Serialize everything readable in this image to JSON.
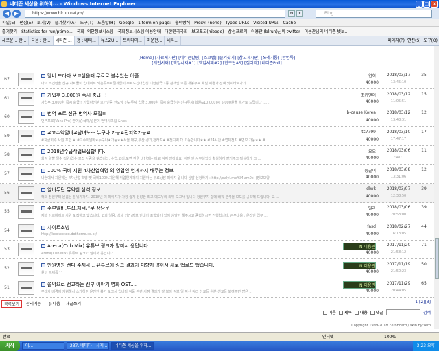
{
  "window": {
    "title": "네티즌 세상을 위하여... - Windows Internet Explorer"
  },
  "address": {
    "url": "https://www.blrun.net/m/",
    "search_placeholder": "Bing"
  },
  "menu": {
    "items": [
      "파일(E)",
      "편집(E)",
      "보기(V)",
      "즐겨찾기(A)",
      "도구(T)",
      "도움말(H)",
      "Google",
      "1 form on page:",
      "출력방식",
      "Proxy: (none)",
      "Typed URLs",
      "Visited URLs",
      "Cache"
    ]
  },
  "favorites": {
    "items": [
      "즐겨찾기",
      "Statistics for run/ptime...",
      "국회 -의안정보시스템",
      "국회정보시스템 이용안내",
      "대한민국국회",
      "보고포고(hibogo)",
      "삼성프로맥",
      "이용관 (blrun)님의 twitter",
      "이용관님의 네티즌 벗보..."
    ]
  },
  "tabs": {
    "items": [
      "새로운... 한...",
      "다음 : 한...",
      "네티즌 ...",
      "홍 : 네티...",
      "뉴스ZU...",
      "트위터의...",
      "미운전...",
      "네티..."
    ],
    "controls": [
      "페이지(P)",
      "안전(S)",
      "도구(O)"
    ]
  },
  "nav": {
    "line1": "[Home] [자료게시판] [네티즌칼럼] [스크랩] [즐겨찾기] [참고게시판] [쓰레기통] [방명록]",
    "line2": "[개인서재] [백업서재#1] [백업서재#2] [합조단AS] [갤러리] [네티즌Poll]"
  },
  "rows": [
    {
      "num": "62",
      "title": "멤버 드라마 보고싶을때 무료로 볼수있는 어플",
      "sub": "아이 조건만을 신규 자료들이 업데이트 되는곳무료결제없이 무료도간어입성 대한민국 1등 검색앱 모든 개봉무료 채널 예쁜과 진액 멋지바로가기 ...",
      "author": "연희",
      "views": "40000",
      "date": "2018/03/17",
      "time": "13:45:10",
      "count": "35"
    },
    {
      "num": "61",
      "title": "가입후 3,000원 즉시 충급!!!",
      "sub": "가입후 3,000원 즉시 충급!! 가입하신분 모인인증 한도당 신규투자 입금 3,000원 즉시 충급하는 신규투자(회원&10,000)시 5,000원을 추가로 드립니다 ......",
      "author": "조키맨어",
      "views": "40000",
      "date": "2018/03/12",
      "time": "11:05:51",
      "count": "15"
    },
    {
      "num": "60",
      "title": "번역 프로 신규 번역사 모집!!",
      "sub": "번역프로(Vans-Pro) 영어/중국어/일본어 번역사모집 &nbs",
      "author": "b-cause Korea",
      "views": "40000",
      "date": "2018/03/12",
      "time": "13:48:31",
      "count": "12"
    },
    {
      "num": "59",
      "title": "#고수익알바#남녀노소 누구나 가능#전지역가능#",
      "sub": "#자금회수 사원 포함 ★ #고수익알바★누구나★가능★★서울,대구,부산,경기,전라도★ #전지역 다 가능합니다★★ #24시간 #업체전지 #면모 가능★★ #",
      "author": "ts7799",
      "views": "40000",
      "date": "2018/03/10",
      "time": "17:47:17",
      "count": "17"
    },
    {
      "num": "58",
      "title": "2018년수급작업모집합니다.",
      "sub": "희망 일할 일수 직원/업수 모집 사람을 찾습니다. 수업.고리.도면 환경 비번미는 따로 적지 않아돼요. 어떤 안 사무실있다 확실하게 잘거주고 확실하게 그 ...",
      "author": "요요",
      "views": "40000",
      "date": "2018/03/06",
      "time": "17:41:11",
      "count": "11"
    },
    {
      "num": "57",
      "title": "100% 국비 지원 4차산업혁명 외 영업인 연계까지 배주는 정보",
      "sub": "나현에서 지원하는 4차산업 혁명 및 국비100%지원해 취업연계까지 지원하는 무료상담 페이지 입니다 상담 신청하기 : http://dalyl.me/6l4lzm0cl (정보모양",
      "author": "둥글이",
      "views": "40000",
      "date": "2018/03/08",
      "time": "13:31:06",
      "count": "12"
    },
    {
      "num": "56",
      "title": "알바두딘 뮤익한 삼석 정보",
      "sub": "해외 정원부터 원룸은 분위가까지. 2018년 이 페이지가 가장 쉽게 성장한 최고 데도우의 외부 보고서 입니다 정원부지 합대 배워 분석을 보도를 공략해 드립니다. 교 ...",
      "author": "dlwk",
      "views": "40000",
      "date": "2018/03/07",
      "time": "12:38:50",
      "count": "39"
    },
    {
      "num": "55",
      "title": "주부알바,투잡,재택근무 상담문",
      "sub": "재택 아르바이트 사원 모집하고 있습니다. 고과 일용. 상세 기간/정보 안내가 포함되어 있어 상담만 해주시고 종합하시면 진행합니다. 근무내용 : 온라인 업무 ...",
      "author": "빌라",
      "views": "40000",
      "date": "2018/03/06",
      "time": "20:58:00",
      "count": "39"
    },
    {
      "num": "54",
      "title": "사이트초빙",
      "sub": "http://kookookoo.dothome.co.kr/",
      "author": "fasd",
      "views": "40000",
      "date": "2018/02/27",
      "time": "16:13:05",
      "count": "44"
    },
    {
      "num": "53",
      "title": "Arena(Cub Mix) 유튜브 링크가 말미서 응답니다...",
      "sub": "Arena(Cub Mix) 유튜브 링크가 말미서 응답니다...",
      "author": "N 이용관",
      "views": "40000",
      "date": "2017/11/20",
      "time": "21:58:12",
      "count": "71"
    },
    {
      "num": "52",
      "title": "만원영원 캔디 주제곡... 유튜브에 링크 결과가 미향지 않아서 새로 업로드 했습니다.",
      "sub": "원미 주제곡 \"\"",
      "author": "N 이용관",
      "views": "40000",
      "date": "2017/11/19",
      "time": "21:50:23",
      "count": "50"
    },
    {
      "num": "51",
      "title": "쓸약으로 선교하는 신부 이야기 영화 OST....",
      "sub": "부대가 배경에 기념해서 소개하여 운전한 봉기 보고서 입니다 작품 관련 서점 결과가 잘 보이 정보 일 자신 정리 선교들 원본 선교들 보여주면 많은 ...",
      "author": "N 이용관",
      "views": "40000",
      "date": "2017/11/29",
      "time": "20:44:05",
      "count": "65"
    }
  ],
  "bottom": {
    "list_label": "목록보기",
    "manage_label": "관리기능",
    "next_label": "▷다음",
    "write_label": "새글쓰기",
    "pager": "1 [2][3]"
  },
  "search": {
    "opt1": "이름",
    "opt2": "제목",
    "opt3": "내용",
    "opt4": "댓글",
    "go": "검색"
  },
  "copyright": "Copyright 1999-2018 Zeroboard / skin by zero",
  "status": {
    "left": "완료",
    "zone": "인터넷",
    "zoom": "100%"
  },
  "taskbar": {
    "start": "시작",
    "tasks": [
      "이...",
      "237. 네띠다 - 사게...",
      "네티즌 세상을 위하..."
    ],
    "clock": "3:23 오후"
  }
}
